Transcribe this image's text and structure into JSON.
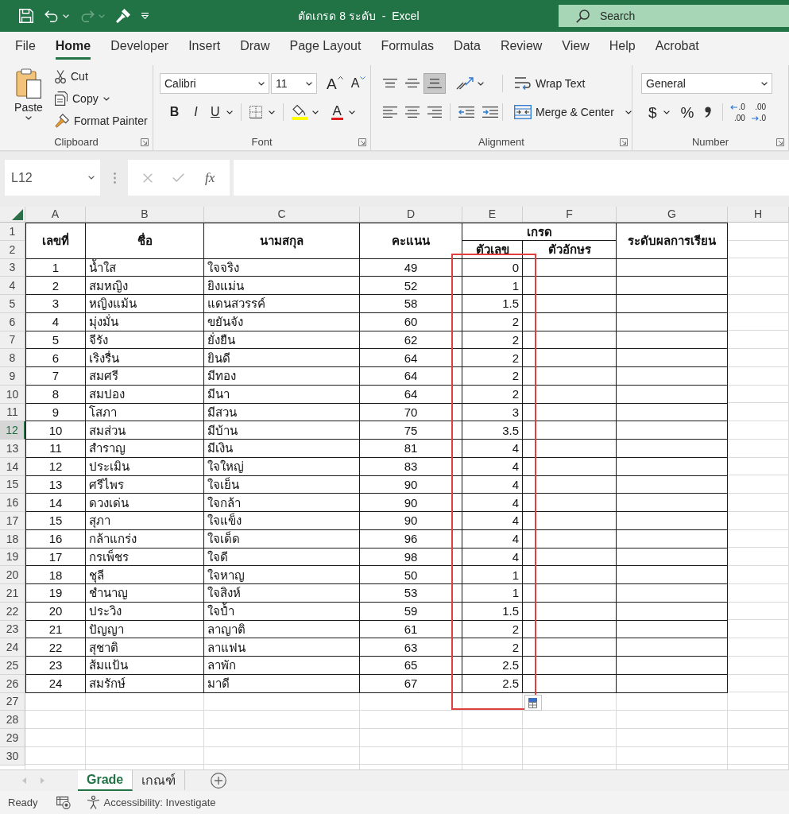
{
  "title_bar": {
    "quick_access": [
      {
        "kind": "save",
        "disabled": false
      },
      {
        "kind": "undo",
        "disabled": false
      },
      {
        "kind": "redo",
        "disabled": true
      },
      {
        "kind": "format-painter",
        "disabled": false
      },
      {
        "kind": "customize",
        "disabled": false
      }
    ],
    "title": "ตัดเกรด 8 ระดับ  -  Excel",
    "search": {
      "placeholder": "Search"
    }
  },
  "tabs": [
    {
      "label": "File",
      "selected": false
    },
    {
      "label": "Home",
      "selected": true
    },
    {
      "label": "Developer",
      "selected": false
    },
    {
      "label": "Insert",
      "selected": false
    },
    {
      "label": "Draw",
      "selected": false
    },
    {
      "label": "Page Layout",
      "selected": false
    },
    {
      "label": "Formulas",
      "selected": false
    },
    {
      "label": "Data",
      "selected": false
    },
    {
      "label": "Review",
      "selected": false
    },
    {
      "label": "View",
      "selected": false
    },
    {
      "label": "Help",
      "selected": false
    },
    {
      "label": "Acrobat",
      "selected": false
    }
  ],
  "ribbon": {
    "groups": [
      {
        "kind": "clipboard",
        "label": "Clipboard",
        "paste": "Paste",
        "cut": "Cut",
        "copy": "Copy",
        "format_painter": "Format Painter"
      },
      {
        "kind": "font",
        "label": "Font",
        "font_name": "Calibri",
        "font_size": "11",
        "grow_font": "A",
        "shrink_font": "A",
        "bold": "B",
        "italic": "I",
        "underline": "U",
        "font_color": "A"
      },
      {
        "kind": "alignment",
        "label": "Alignment",
        "buttons": [
          {
            "kind": "top",
            "pressed": false
          },
          {
            "kind": "middle",
            "pressed": false
          },
          {
            "kind": "bottom",
            "pressed": true
          },
          {
            "kind": "left",
            "pressed": false
          },
          {
            "kind": "center",
            "pressed": false
          },
          {
            "kind": "right",
            "pressed": false
          }
        ],
        "wrap_text": "Wrap Text",
        "merge_center": "Merge & Center"
      },
      {
        "kind": "number",
        "label": "Number",
        "format": "General",
        "currency": "$",
        "percent": "%",
        "increase_decimal": [
          ".0",
          ".00"
        ],
        "decrease_decimal": [
          ".00",
          ".0"
        ]
      }
    ]
  },
  "formula_bar": {
    "name_box": "L12",
    "cancel": {
      "disabled": true
    },
    "enter": {
      "disabled": true
    },
    "function_label": "fx"
  },
  "sheet": {
    "column_headers": [
      "A",
      "B",
      "C",
      "D",
      "E",
      "F",
      "G",
      "H"
    ],
    "row_headers": [
      {
        "label": "1",
        "selected": false
      },
      {
        "label": "2",
        "selected": false
      },
      {
        "label": "3",
        "selected": false
      },
      {
        "label": "4",
        "selected": false
      },
      {
        "label": "5",
        "selected": false
      },
      {
        "label": "6",
        "selected": false
      },
      {
        "label": "7",
        "selected": false
      },
      {
        "label": "8",
        "selected": false
      },
      {
        "label": "9",
        "selected": false
      },
      {
        "label": "10",
        "selected": false
      },
      {
        "label": "11",
        "selected": false
      },
      {
        "label": "12",
        "selected": true
      },
      {
        "label": "13",
        "selected": false
      },
      {
        "label": "14",
        "selected": false
      },
      {
        "label": "15",
        "selected": false
      },
      {
        "label": "16",
        "selected": false
      },
      {
        "label": "17",
        "selected": false
      },
      {
        "label": "18",
        "selected": false
      },
      {
        "label": "19",
        "selected": false
      },
      {
        "label": "20",
        "selected": false
      },
      {
        "label": "21",
        "selected": false
      },
      {
        "label": "22",
        "selected": false
      },
      {
        "label": "23",
        "selected": false
      },
      {
        "label": "24",
        "selected": false
      },
      {
        "label": "25",
        "selected": false
      },
      {
        "label": "26",
        "selected": false
      },
      {
        "label": "27",
        "selected": false
      },
      {
        "label": "28",
        "selected": false
      },
      {
        "label": "29",
        "selected": false
      },
      {
        "label": "30",
        "selected": false
      }
    ],
    "header": {
      "number": "เลขที่",
      "first_name": "ชื่อ",
      "last_name": "นามสกุล",
      "score": "คะแนน",
      "grade": "เกรด",
      "grade_number": "ตัวเลข",
      "grade_letter": "ตัวอักษร",
      "result_level": "ระดับผลการเรียน"
    },
    "records": [
      {
        "number": "1",
        "first_name": "น้ำใส",
        "last_name": "ใจจริง",
        "score": "49",
        "grade_number": "0"
      },
      {
        "number": "2",
        "first_name": "สมหญิง",
        "last_name": "ยิงแม่น",
        "score": "52",
        "grade_number": "1"
      },
      {
        "number": "3",
        "first_name": "หญิงแม้น",
        "last_name": "แดนสวรรค์",
        "score": "58",
        "grade_number": "1.5"
      },
      {
        "number": "4",
        "first_name": "มุ่งมั่น",
        "last_name": "ขยันจัง",
        "score": "60",
        "grade_number": "2"
      },
      {
        "number": "5",
        "first_name": "จีรัง",
        "last_name": "ยั่งยืน",
        "score": "62",
        "grade_number": "2"
      },
      {
        "number": "6",
        "first_name": "เริงรื่น",
        "last_name": "ยินดี",
        "score": "64",
        "grade_number": "2"
      },
      {
        "number": "7",
        "first_name": "สมศรี",
        "last_name": "มีทอง",
        "score": "64",
        "grade_number": "2"
      },
      {
        "number": "8",
        "first_name": "สมปอง",
        "last_name": "มีนา",
        "score": "64",
        "grade_number": "2"
      },
      {
        "number": "9",
        "first_name": "โสภา",
        "last_name": "มีสวน",
        "score": "70",
        "grade_number": "3"
      },
      {
        "number": "10",
        "first_name": "สมส่วน",
        "last_name": "มีบ้าน",
        "score": "75",
        "grade_number": "3.5"
      },
      {
        "number": "11",
        "first_name": "สำราญ",
        "last_name": "มีเงิน",
        "score": "81",
        "grade_number": "4"
      },
      {
        "number": "12",
        "first_name": "ประเมิน",
        "last_name": "ใจใหญ่",
        "score": "83",
        "grade_number": "4"
      },
      {
        "number": "13",
        "first_name": "ศรีไพร",
        "last_name": "ใจเย็น",
        "score": "90",
        "grade_number": "4"
      },
      {
        "number": "14",
        "first_name": "ดวงเด่น",
        "last_name": "ใจกล้า",
        "score": "90",
        "grade_number": "4"
      },
      {
        "number": "15",
        "first_name": "สุภา",
        "last_name": "ใจแข็ง",
        "score": "90",
        "grade_number": "4"
      },
      {
        "number": "16",
        "first_name": "กล้าแกร่ง",
        "last_name": "ใจเด็ด",
        "score": "96",
        "grade_number": "4"
      },
      {
        "number": "17",
        "first_name": "กรเพ็ชร",
        "last_name": "ใจดี",
        "score": "98",
        "grade_number": "4"
      },
      {
        "number": "18",
        "first_name": "ชุลี",
        "last_name": "ใจหาญ",
        "score": "50",
        "grade_number": "1"
      },
      {
        "number": "19",
        "first_name": "ชำนาญ",
        "last_name": "ใจสิงห์",
        "score": "53",
        "grade_number": "1"
      },
      {
        "number": "20",
        "first_name": "ประวิง",
        "last_name": "ใจป้ำ",
        "score": "59",
        "grade_number": "1.5"
      },
      {
        "number": "21",
        "first_name": "ปัญญา",
        "last_name": "ลาญาติ",
        "score": "61",
        "grade_number": "2"
      },
      {
        "number": "22",
        "first_name": "สุชาติ",
        "last_name": "ลาแฟน",
        "score": "63",
        "grade_number": "2"
      },
      {
        "number": "23",
        "first_name": "ส้มแป้น",
        "last_name": "ลาพัก",
        "score": "65",
        "grade_number": "2.5"
      },
      {
        "number": "24",
        "first_name": "สมรักษ์",
        "last_name": "มาดี",
        "score": "67",
        "grade_number": "2.5"
      }
    ]
  },
  "sheet_tabs": [
    {
      "label": "Grade",
      "selected": true
    },
    {
      "label": "เกณฑ์",
      "selected": false
    }
  ],
  "status_bar": {
    "mode": "Ready",
    "accessibility": "Accessibility: Investigate"
  }
}
